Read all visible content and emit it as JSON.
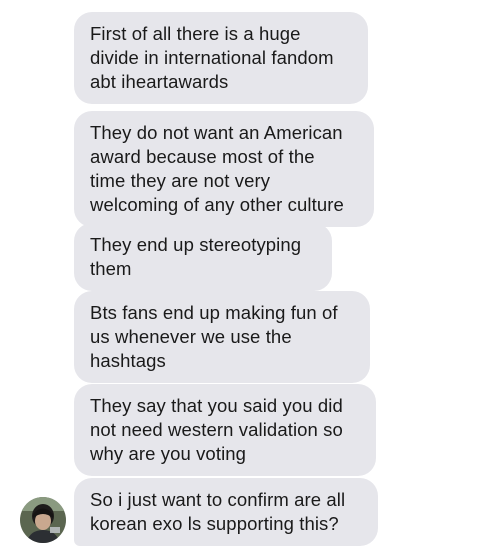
{
  "thread": {
    "messages": [
      {
        "text": "First of all there is a huge\ndivide in international fandom\nabt iheartawards"
      },
      {
        "text": "They do not want an American\naward because most of the\ntime they are not very\nwelcoming of any other culture"
      },
      {
        "text": "They end up stereotyping\nthem"
      },
      {
        "text": "Bts fans end up making fun of\nus whenever we use the\nhashtags"
      },
      {
        "text": "They say that you said you did\nnot need western validation so\nwhy are you voting"
      },
      {
        "text": "So i just want to confirm are all\nkorean exo ls supporting this?"
      }
    ]
  },
  "colors": {
    "bubble_bg": "#e6e6eb",
    "text": "#1a1a1a",
    "background": "#ffffff"
  }
}
